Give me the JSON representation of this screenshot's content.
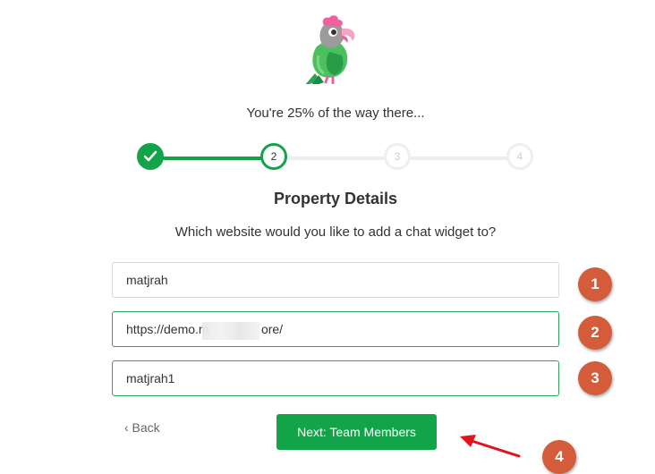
{
  "logo": {
    "icon": "parrot-logo-icon"
  },
  "progress_text": "You're 25% of the way there...",
  "stepper": {
    "progress_percent": 25,
    "steps": [
      {
        "label": "✓",
        "state": "complete"
      },
      {
        "label": "2",
        "state": "current"
      },
      {
        "label": "3",
        "state": "pending"
      },
      {
        "label": "4",
        "state": "pending"
      }
    ]
  },
  "section_title": "Property Details",
  "question": "Which website would you like to add a chat widget to?",
  "fields": {
    "property_name": {
      "value": "matjrah"
    },
    "website_url": {
      "value": "https://demo.m               ore/"
    },
    "widget_name": {
      "value": "matjrah1"
    }
  },
  "markers": [
    "1",
    "2",
    "3",
    "4"
  ],
  "back_label": "‹ Back",
  "next_label": "Next: Team Members",
  "colors": {
    "brand_green": "#13a44a",
    "marker_orange": "#d45c3a",
    "arrow_red": "#e4131b"
  }
}
